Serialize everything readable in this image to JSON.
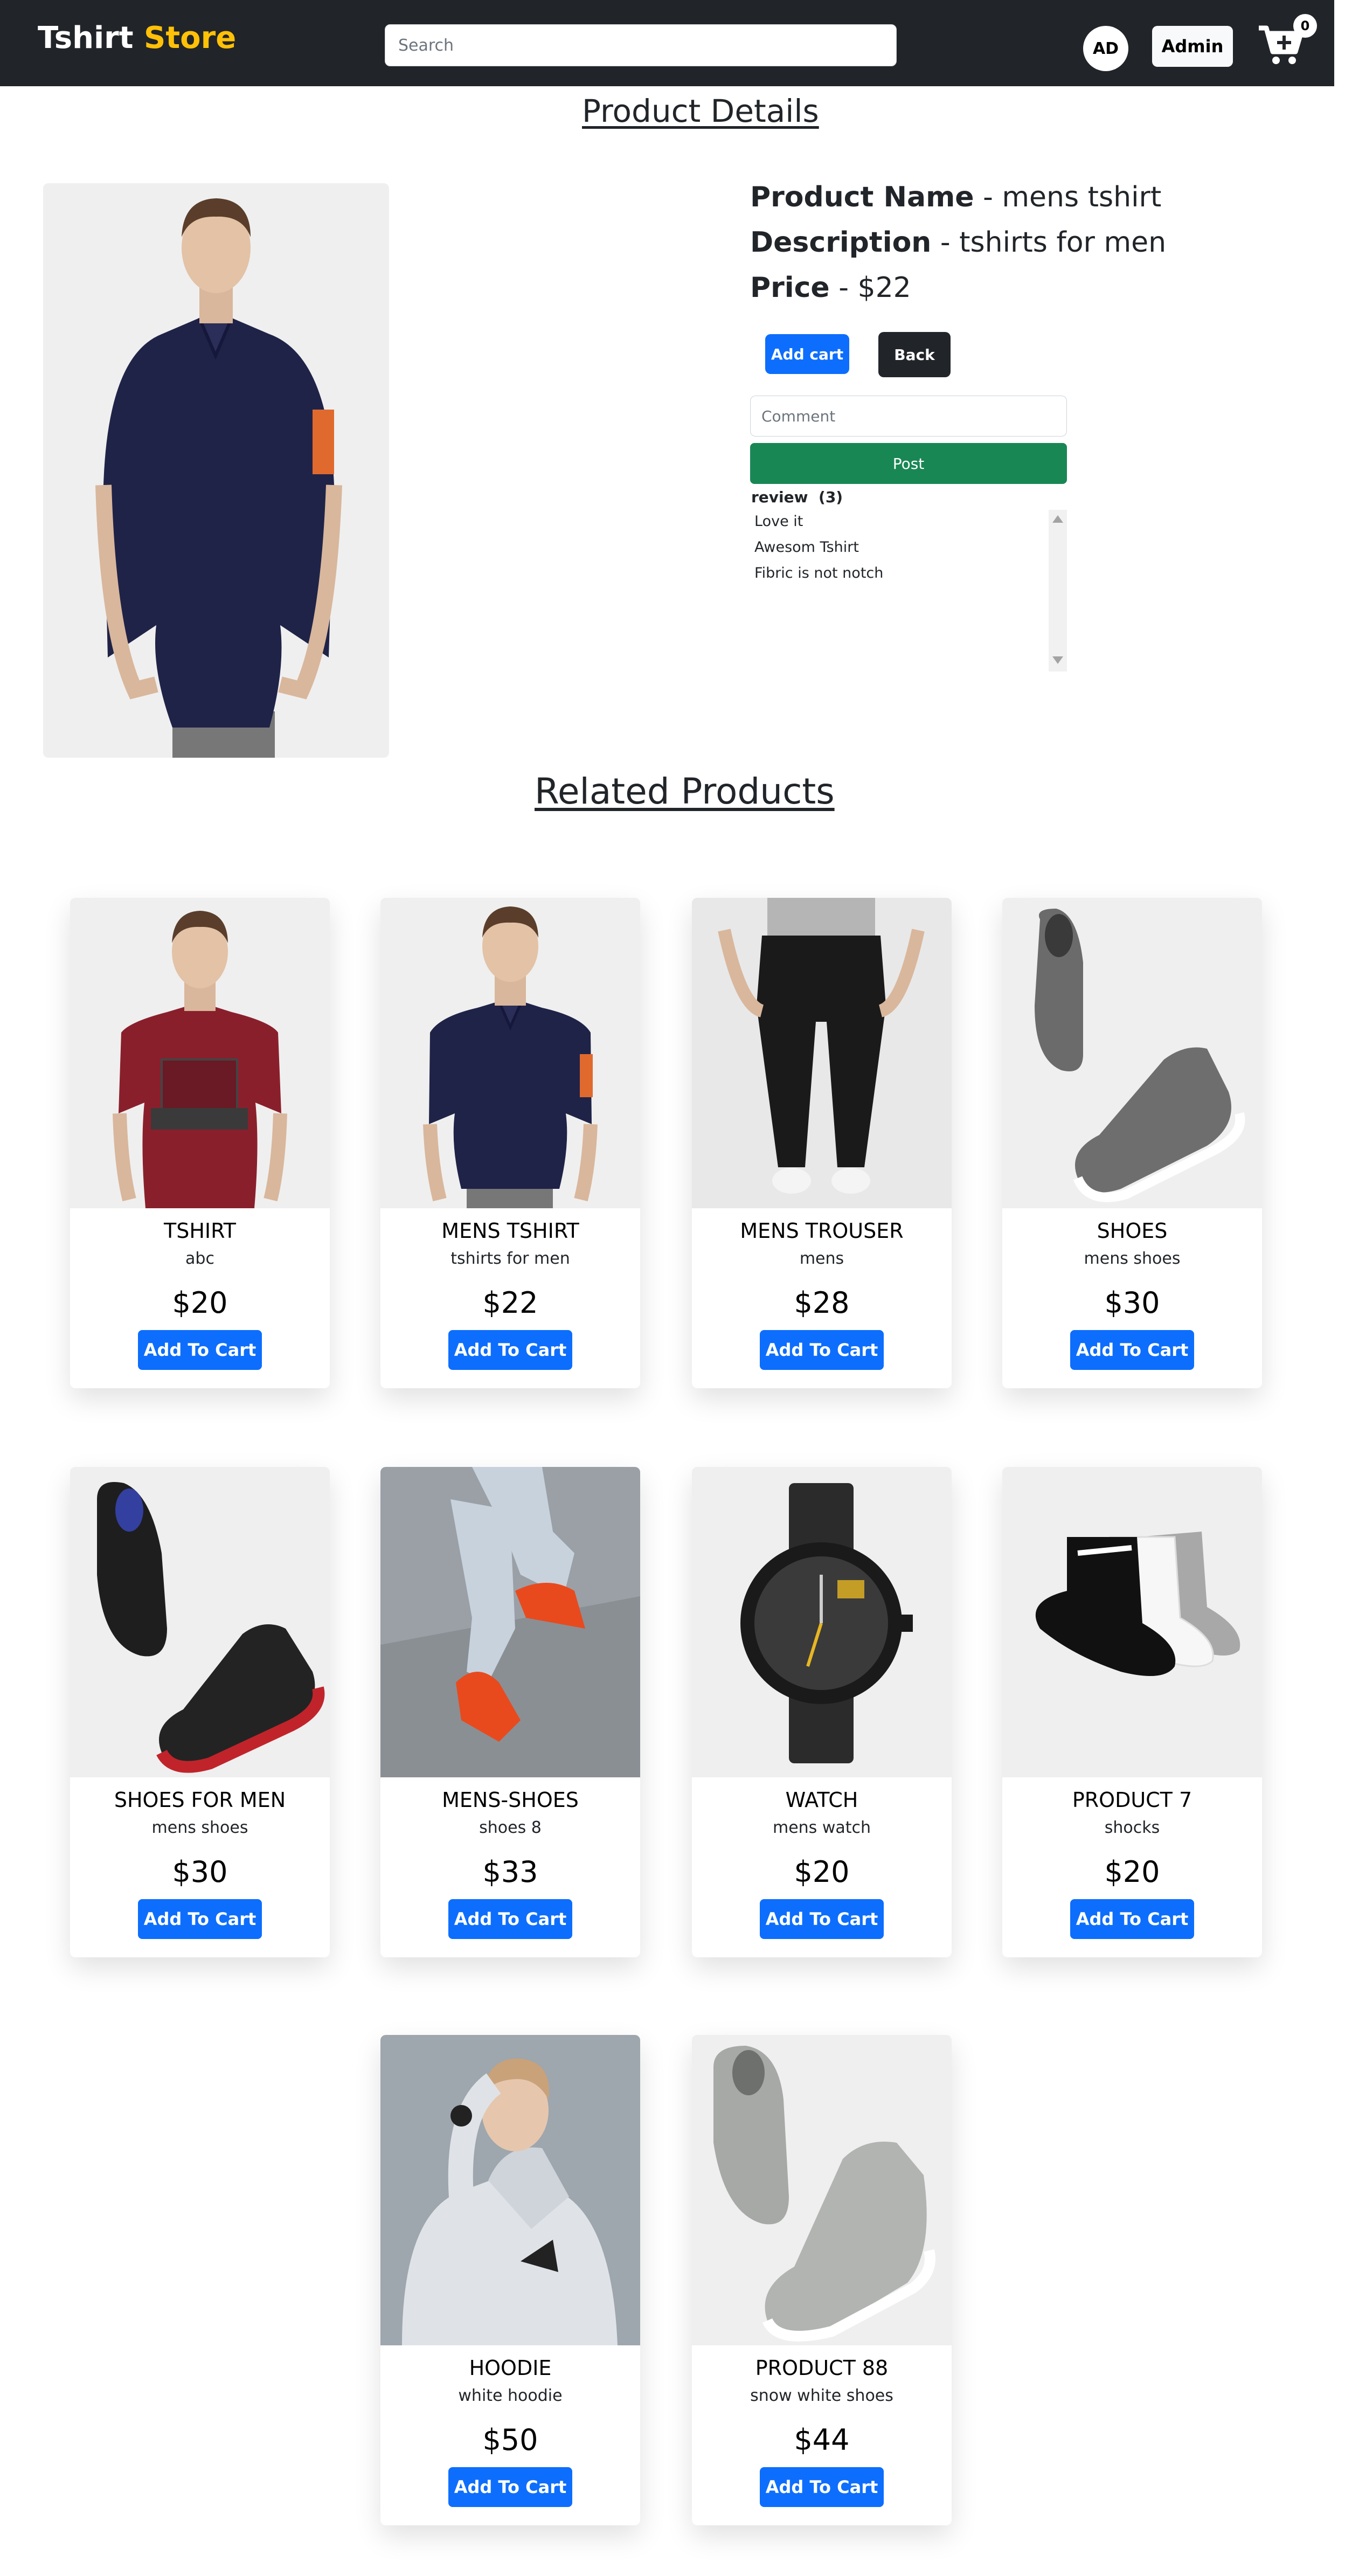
{
  "header": {
    "brand_main": "Tshirt ",
    "brand_accent": "Store",
    "search_placeholder": "Search",
    "avatar_initials": "AD",
    "admin_label": "Admin",
    "cart_count": "0"
  },
  "page_title": "Product Details",
  "product": {
    "name_label": "Product Name",
    "name": "mens tshirt",
    "description_label": "Description",
    "description": "tshirts for men",
    "price_label": "Price",
    "price": "$22",
    "add_cart_label": "Add cart",
    "back_label": "Back",
    "comment_placeholder": "Comment",
    "post_label": "Post",
    "review_label": "review",
    "review_count": "(3)",
    "reviews": [
      "Love it",
      "Awesom Tshirt",
      "Fibric is not notch"
    ]
  },
  "related_title": "Related Products",
  "button_label": "Add To Cart",
  "cards": [
    {
      "name": "TSHIRT",
      "desc": "abc",
      "price": "$20",
      "button": "Add To Cart"
    },
    {
      "name": "MENS TSHIRT",
      "desc": "tshirts for men",
      "price": "$22",
      "button": "Add To Cart"
    },
    {
      "name": "MENS TROUSER",
      "desc": "mens",
      "price": "$28",
      "button": "Add To Cart"
    },
    {
      "name": "SHOES",
      "desc": "mens shoes",
      "price": "$30",
      "button": "Add To Cart"
    },
    {
      "name": "SHOES FOR MEN",
      "desc": "mens shoes",
      "price": "$30",
      "button": "Add To Cart"
    },
    {
      "name": "MENS-SHOES",
      "desc": "shoes 8",
      "price": "$33",
      "button": "Add To Cart"
    },
    {
      "name": "WATCH",
      "desc": "mens watch",
      "price": "$20",
      "button": "Add To Cart"
    },
    {
      "name": "PRODUCT 7",
      "desc": "shocks",
      "price": "$20",
      "button": "Add To Cart"
    },
    {
      "name": "HOODIE",
      "desc": "white hoodie",
      "price": "$50",
      "button": "Add To Cart"
    },
    {
      "name": "PRODUCT 88",
      "desc": "snow white shoes",
      "price": "$44",
      "button": "Add To Cart"
    }
  ],
  "colors": {
    "navbar": "#212529",
    "brand_accent": "#ffc107",
    "primary": "#0d6efd",
    "success": "#198754"
  }
}
